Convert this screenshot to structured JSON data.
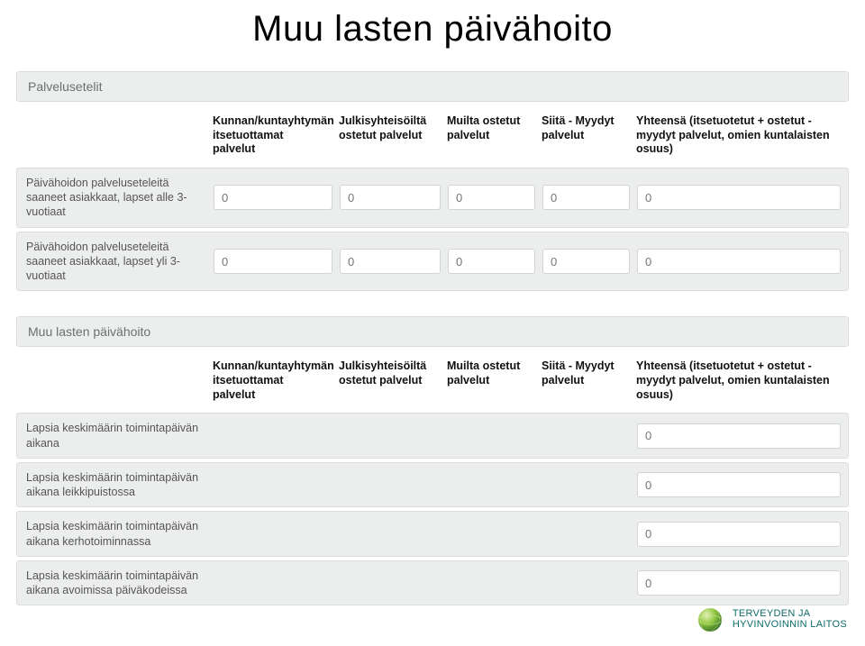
{
  "title": "Muu lasten päivähoito",
  "section1": {
    "header": "Palvelusetelit",
    "columns": {
      "c1": "",
      "c2": "Kunnan/kuntayhtymän itsetuottamat palvelut",
      "c3": "Julkisyhteisöiltä ostetut palvelut",
      "c4": "Muilta ostetut palvelut",
      "c5": "Siitä - Myydyt palvelut",
      "c6": "Yhteensä (itsetuotetut + ostetut - myydyt palvelut, omien kuntalaisten osuus)"
    },
    "rows": [
      {
        "label": "Päivähoidon palveluseteleitä saaneet asiakkaat, lapset alle 3-vuotiaat",
        "v1": "0",
        "v2": "0",
        "v3": "0",
        "v4": "0",
        "v5": "0"
      },
      {
        "label": "Päivähoidon palveluseteleitä saaneet asiakkaat, lapset yli 3-vuotiaat",
        "v1": "0",
        "v2": "0",
        "v3": "0",
        "v4": "0",
        "v5": "0"
      }
    ]
  },
  "section2": {
    "header": "Muu lasten päivähoito",
    "columns": {
      "c1": "",
      "c2": "Kunnan/kuntayhtymän itsetuottamat palvelut",
      "c3": "Julkisyhteisöiltä ostetut palvelut",
      "c4": "Muilta ostetut palvelut",
      "c5": "Siitä - Myydyt palvelut",
      "c6": "Yhteensä (itsetuotetut + ostetut - myydyt palvelut, omien kuntalaisten osuus)"
    },
    "rows": [
      {
        "label": "Lapsia keskimäärin toimintapäivän aikana",
        "v": "0"
      },
      {
        "label": "Lapsia keskimäärin toimintapäivän aikana leikkipuistossa",
        "v": "0"
      },
      {
        "label": "Lapsia keskimäärin toimintapäivän aikana kerhotoiminnassa",
        "v": "0"
      },
      {
        "label": "Lapsia keskimäärin toimintapäivän aikana avoimissa päiväkodeissa",
        "v": "0"
      }
    ]
  },
  "logo": {
    "line1": "TERVEYDEN JA",
    "line2": "HYVINVOINNIN LAITOS"
  }
}
